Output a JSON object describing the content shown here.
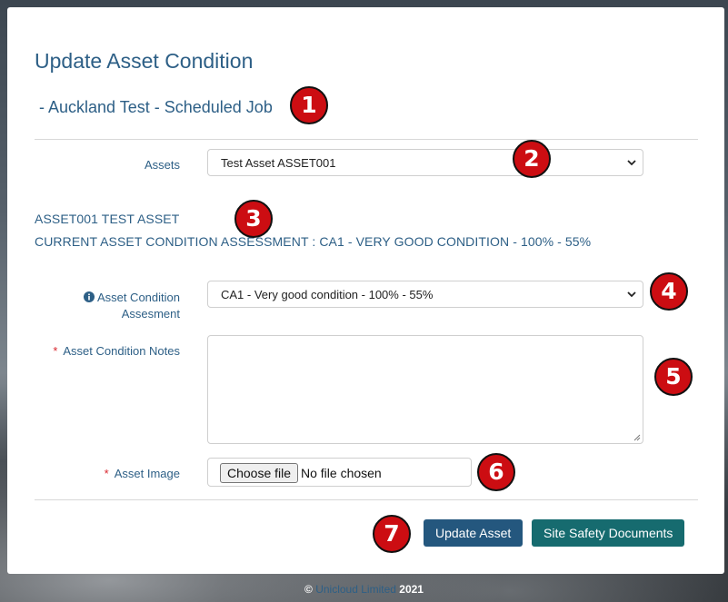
{
  "page": {
    "title": "Update Asset Condition",
    "subtitle": "- Auckland Test - Scheduled Job"
  },
  "form": {
    "assets": {
      "label": "Assets",
      "selected": "Test Asset ASSET001"
    },
    "asset_info": {
      "name": "ASSET001 TEST ASSET",
      "current_assessment": "CURRENT ASSET CONDITION ASSESSMENT : CA1 - VERY GOOD CONDITION - 100% - 55%"
    },
    "condition": {
      "label_line1": "Asset Condition",
      "label_line2": "Assesment",
      "selected": "CA1 - Very good condition - 100% - 55%",
      "icon": "info-circle-icon"
    },
    "notes": {
      "required_mark": "*",
      "label": "Asset Condition Notes",
      "value": ""
    },
    "image": {
      "required_mark": "*",
      "label": "Asset Image",
      "button_label": "Choose file",
      "status": "No file chosen"
    }
  },
  "actions": {
    "update_label": "Update Asset",
    "safety_label": "Site Safety Documents"
  },
  "badges": [
    "1",
    "2",
    "3",
    "4",
    "5",
    "6",
    "7"
  ],
  "footer": {
    "copyright": "©",
    "brand": "Unicloud Limited",
    "year": "2021"
  },
  "colors": {
    "primary_text": "#2d5f86",
    "update_button": "#24577e",
    "safety_button": "#166b6f",
    "required": "#d9262e",
    "badge": "#cc0d12"
  }
}
